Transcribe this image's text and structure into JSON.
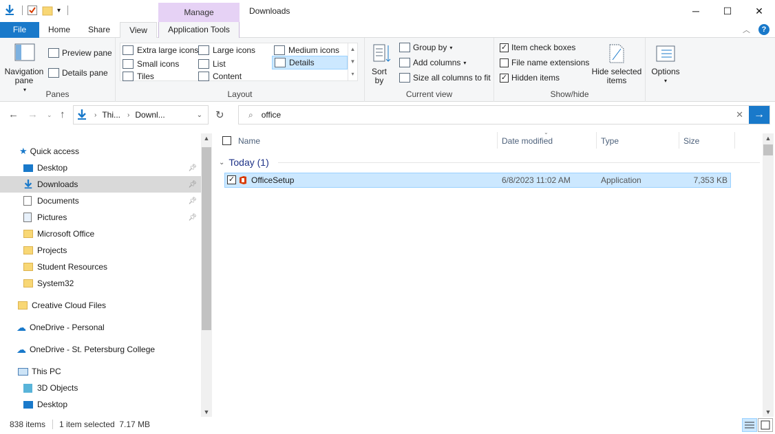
{
  "window": {
    "title": "Downloads",
    "context_tab": "Manage",
    "minimize_icon": "─",
    "maximize_icon": "☐",
    "close_icon": "✕"
  },
  "ribbon_tabs": {
    "file": "File",
    "home": "Home",
    "share": "Share",
    "view": "View",
    "app_tools": "Application Tools"
  },
  "ribbon": {
    "panes": {
      "navigation_pane": "Navigation pane",
      "preview_pane": "Preview pane",
      "details_pane": "Details pane",
      "label": "Panes"
    },
    "layout": {
      "extra_large_icons": "Extra large icons",
      "large_icons": "Large icons",
      "medium_icons": "Medium icons",
      "small_icons": "Small icons",
      "list": "List",
      "details": "Details",
      "tiles": "Tiles",
      "content": "Content",
      "label": "Layout"
    },
    "current_view": {
      "sort_by": "Sort by",
      "group_by": "Group by",
      "add_columns": "Add columns",
      "size_all_columns": "Size all columns to fit",
      "label": "Current view"
    },
    "show_hide": {
      "item_check_boxes": "Item check boxes",
      "item_check_boxes_checked": true,
      "file_name_extensions": "File name extensions",
      "file_name_extensions_checked": false,
      "hidden_items": "Hidden items",
      "hidden_items_checked": true,
      "hide_selected_items": "Hide selected items",
      "label": "Show/hide"
    },
    "options": "Options"
  },
  "address": {
    "crumb1": "Thi...",
    "crumb2": "Downl...",
    "search_value": "office"
  },
  "nav_pane": {
    "quick_access": "Quick access",
    "items": [
      {
        "label": "Desktop",
        "pinned": true
      },
      {
        "label": "Downloads",
        "pinned": true,
        "selected": true
      },
      {
        "label": "Documents",
        "pinned": true
      },
      {
        "label": "Pictures",
        "pinned": true
      },
      {
        "label": "Microsoft Office"
      },
      {
        "label": "Projects"
      },
      {
        "label": "Student Resources"
      },
      {
        "label": "System32"
      }
    ],
    "creative_cloud": "Creative Cloud Files",
    "onedrive_personal": "OneDrive - Personal",
    "onedrive_spc": "OneDrive - St. Petersburg College",
    "this_pc": "This PC",
    "objects_3d": "3D Objects",
    "desktop2": "Desktop"
  },
  "columns": {
    "name": "Name",
    "date_modified": "Date modified",
    "type": "Type",
    "size": "Size"
  },
  "group": {
    "label": "Today (1)"
  },
  "files": [
    {
      "name": "OfficeSetup",
      "date": "6/8/2023 11:02 AM",
      "type": "Application",
      "size": "7,353 KB"
    }
  ],
  "status": {
    "item_count": "838 items",
    "selection": "1 item selected  7.17 MB"
  },
  "colors": {
    "accent": "#1979ca",
    "selection": "#cce8ff",
    "manage_tab": "#e6d2f5",
    "group_header": "#1e3287"
  }
}
